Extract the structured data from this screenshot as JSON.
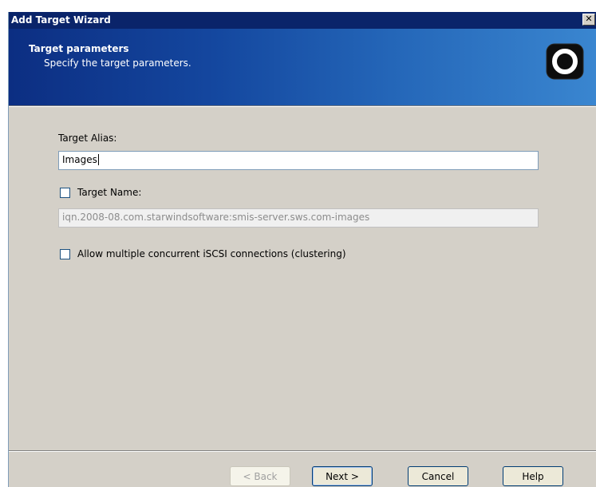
{
  "window": {
    "title": "Add Target Wizard",
    "close_glyph": "✕"
  },
  "header": {
    "title": "Target parameters",
    "subtitle": "Specify the target parameters."
  },
  "form": {
    "alias_label": "Target Alias:",
    "alias_value": "Images",
    "target_name_label": "Target Name:",
    "target_name_checked": false,
    "target_name_value": "iqn.2008-08.com.starwindsoftware:smis-server.sws.com-images",
    "clustering_label": "Allow multiple concurrent iSCSI connections (clustering)",
    "clustering_checked": false
  },
  "buttons": {
    "back": "< Back",
    "next": "Next >",
    "cancel": "Cancel",
    "help": "Help"
  },
  "colors": {
    "titlebar": "#0a246a",
    "banner_start": "#0c2e82",
    "banner_end": "#3a86d0",
    "dialog_bg": "#d4d0c8"
  },
  "icons": {
    "logo": "starwind-logo-icon",
    "close": "close-icon"
  }
}
